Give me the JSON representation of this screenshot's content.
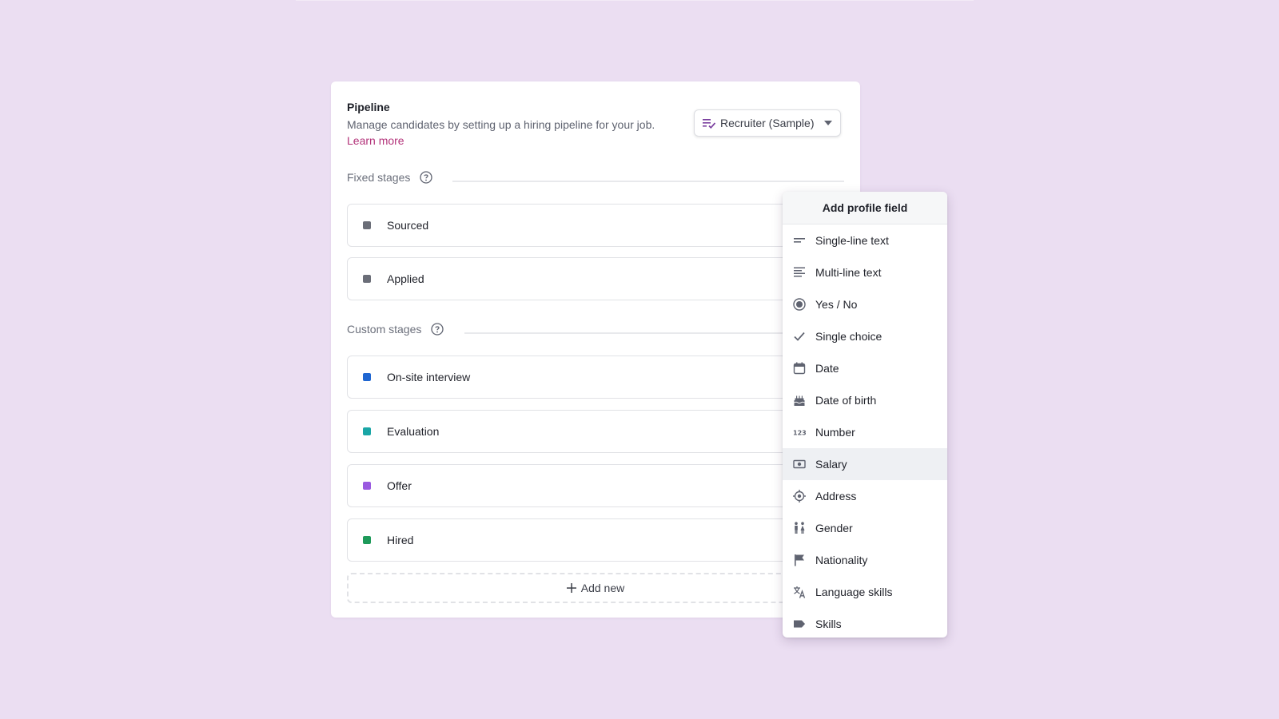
{
  "pipeline": {
    "title": "Pipeline",
    "description": "Manage candidates by setting up a hiring pipeline for your job.",
    "learn_more": "Learn more",
    "template_dropdown": {
      "selected": "Recruiter (Sample)"
    }
  },
  "fixed_section": {
    "label": "Fixed stages",
    "stages": [
      {
        "label": "Sourced",
        "color": "#6b6e78"
      },
      {
        "label": "Applied",
        "color": "#6b6e78"
      }
    ]
  },
  "custom_section": {
    "label": "Custom stages",
    "stages": [
      {
        "label": "On-site interview",
        "color": "#1f66d1"
      },
      {
        "label": "Evaluation",
        "color": "#1aa6a6"
      },
      {
        "label": "Offer",
        "color": "#9a5ae0"
      },
      {
        "label": "Hired",
        "color": "#1e9a5a"
      }
    ],
    "add_new": "Add new"
  },
  "profile_menu": {
    "header": "Add profile field",
    "items": [
      {
        "label": "Single-line text",
        "icon": "single-line-text-icon"
      },
      {
        "label": "Multi-line text",
        "icon": "multi-line-text-icon"
      },
      {
        "label": "Yes / No",
        "icon": "radio-icon"
      },
      {
        "label": "Single choice",
        "icon": "check-icon"
      },
      {
        "label": "Date",
        "icon": "calendar-icon"
      },
      {
        "label": "Date of birth",
        "icon": "cake-icon"
      },
      {
        "label": "Number",
        "icon": "number-icon"
      },
      {
        "label": "Salary",
        "icon": "money-icon",
        "highlighted": true
      },
      {
        "label": "Address",
        "icon": "location-icon"
      },
      {
        "label": "Gender",
        "icon": "gender-icon"
      },
      {
        "label": "Nationality",
        "icon": "flag-icon"
      },
      {
        "label": "Language skills",
        "icon": "translate-icon"
      },
      {
        "label": "Skills",
        "icon": "tag-icon"
      }
    ]
  },
  "colors": {
    "accent_link": "#b3337a",
    "icon": "#5f6370"
  }
}
